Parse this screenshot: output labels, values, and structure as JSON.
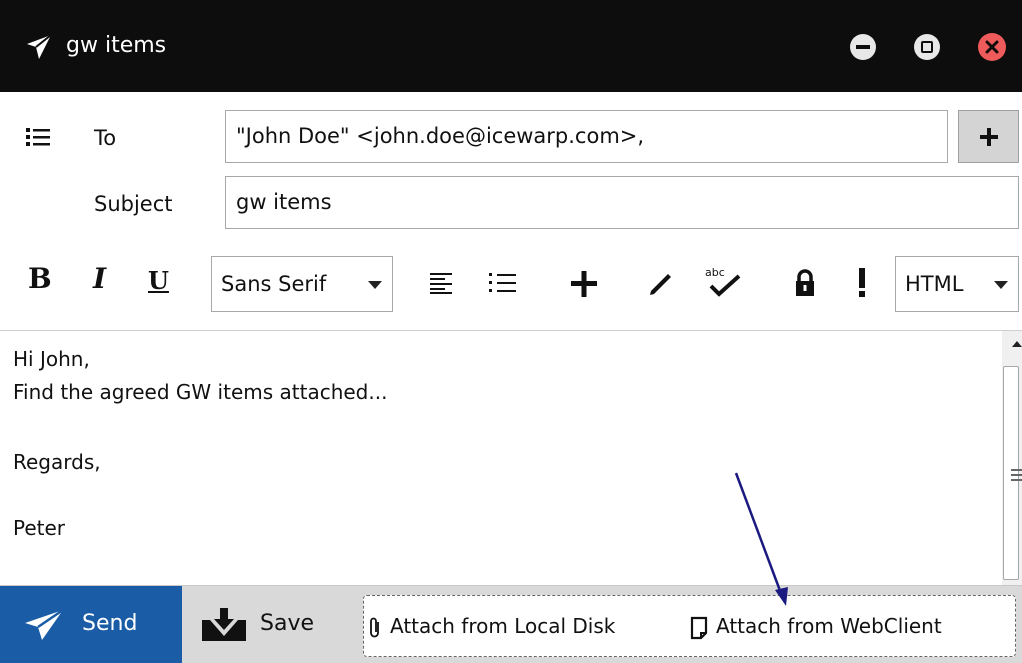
{
  "window": {
    "title": "gw items",
    "controls": [
      "minimize",
      "maximize",
      "close"
    ],
    "close_color": "#ef5a5a"
  },
  "header": {
    "to_label": "To",
    "to_value": "\"John Doe\" <john.doe@icewarp.com>,",
    "subject_label": "Subject",
    "subject_value": "gw items"
  },
  "toolbar": {
    "bold": "B",
    "italic": "I",
    "underline": "U",
    "font": "Sans Serif",
    "format": "HTML",
    "icons": [
      "align-left-icon",
      "bullet-list-icon",
      "plus-icon",
      "pen-icon",
      "spellcheck-icon",
      "lock-icon",
      "exclamation-icon"
    ]
  },
  "body": {
    "lines": [
      "Hi John,",
      "Find the agreed GW items attached...",
      "Regards,",
      "Peter"
    ]
  },
  "footer": {
    "send_label": "Send",
    "save_label": "Save",
    "attach_local": "Attach from Local Disk",
    "attach_web": "Attach from WebClient",
    "send_color": "#1a5ca6"
  }
}
